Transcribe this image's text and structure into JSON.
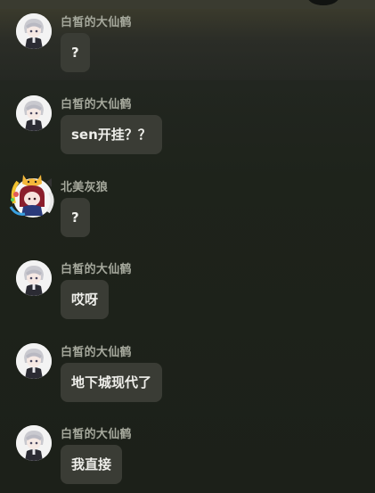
{
  "messages": [
    {
      "sender": "白皙的大仙鹤",
      "text": "?",
      "avatar": "white-hair-avatar-icon"
    },
    {
      "sender": "白皙的大仙鹤",
      "text": "sen开挂？？",
      "avatar": "white-hair-avatar-icon"
    },
    {
      "sender": "北美灰狼",
      "text": "?",
      "avatar": "red-hair-cat-avatar-icon"
    },
    {
      "sender": "白皙的大仙鹤",
      "text": "哎呀",
      "avatar": "white-hair-avatar-icon"
    },
    {
      "sender": "白皙的大仙鹤",
      "text": "地下城现代了",
      "avatar": "white-hair-avatar-icon"
    },
    {
      "sender": "白皙的大仙鹤",
      "text": "我直接",
      "avatar": "white-hair-avatar-icon"
    }
  ],
  "colors": {
    "background": "#1e231b",
    "bubble": "#3a3c35",
    "sender_text": "#a5a89c",
    "message_text": "#eeeeea"
  }
}
